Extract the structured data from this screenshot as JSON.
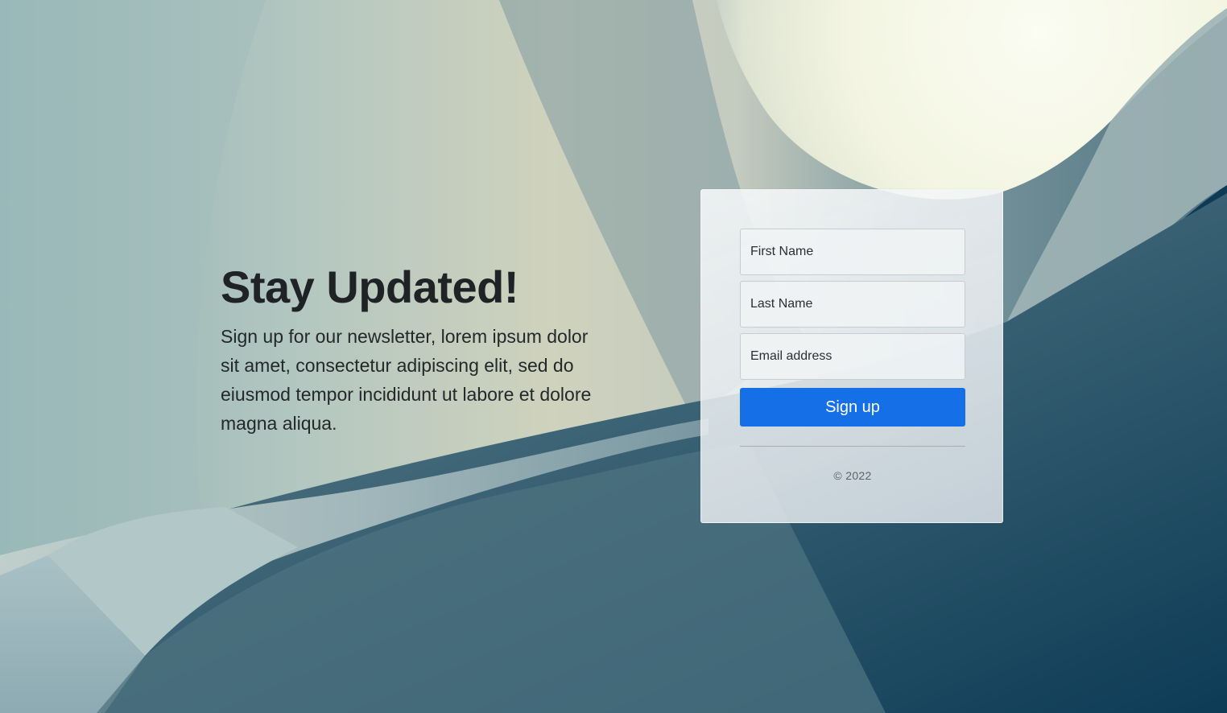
{
  "hero": {
    "title": "Stay Updated!",
    "description": "Sign up for our newsletter, lorem ipsum dolor sit amet, consectetur adipiscing elit, sed do eiusmod tempor incididunt ut labore et dolore magna aliqua."
  },
  "form": {
    "first_name_placeholder": "First Name",
    "last_name_placeholder": "Last Name",
    "email_placeholder": "Email address",
    "submit_label": "Sign up",
    "copyright": "© 2022"
  },
  "colors": {
    "accent": "#1570e8",
    "text_dark": "#1f2326",
    "card_background": "#eef1f3"
  },
  "icons": {
    "background": "abstract-architecture-background-image"
  }
}
